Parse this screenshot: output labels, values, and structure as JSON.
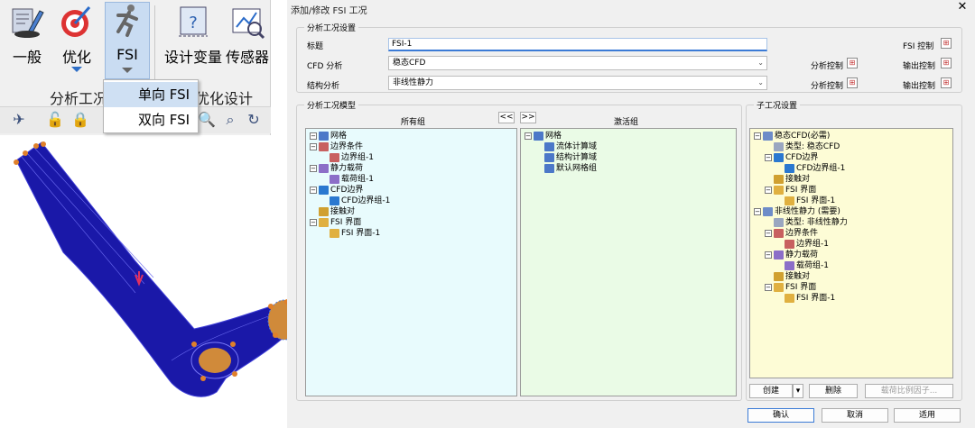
{
  "ribbon": {
    "buttons": [
      {
        "label": "一般",
        "icon": "general-settings-icon"
      },
      {
        "label": "优化",
        "icon": "optimization-target-icon"
      },
      {
        "label": "FSI",
        "icon": "running-man-icon"
      },
      {
        "label": "设计变量",
        "icon": "design-variable-icon"
      },
      {
        "label": "传感器",
        "icon": "sensor-chart-icon"
      }
    ],
    "group_label": "分析工况",
    "group_label2": "优化设计",
    "fsi_menu": [
      "单向 FSI",
      "双向 FSI"
    ]
  },
  "dialog": {
    "title": "添加/修改 FSI 工况",
    "settings": {
      "legend": "分析工况设置",
      "title_label": "标题",
      "title_value": "FSI-1",
      "cfd_label": "CFD 分析",
      "cfd_value": "稳态CFD",
      "struct_label": "结构分析",
      "struct_value": "非线性静力",
      "fsi_control": "FSI 控制",
      "analysis_control": "分析控制",
      "output_control": "输出控制"
    },
    "model": {
      "legend": "分析工况模型",
      "all_groups": "所有组",
      "active_groups": "激活组",
      "btn_left": "<<",
      "btn_right": ">>",
      "left_tree": [
        "网格",
        "边界条件",
        "边界组-1",
        "静力载荷",
        "载荷组-1",
        "CFD边界",
        "CFD边界组-1",
        "接触对",
        "FSI 界面",
        "FSI 界面-1"
      ],
      "right_tree": [
        "网格",
        "流体计算域",
        "结构计算域",
        "默认网格组"
      ]
    },
    "sub": {
      "legend": "子工况设置",
      "tree": [
        "稳态CFD(必需)",
        "类型: 稳态CFD",
        "CFD边界",
        "CFD边界组-1",
        "接触对",
        "FSI 界面",
        "FSI 界面-1",
        "非线性静力 (需要)",
        "类型: 非线性静力",
        "边界条件",
        "边界组-1",
        "静力载荷",
        "载荷组-1",
        "接触对",
        "FSI 界面",
        "FSI 界面-1"
      ],
      "create": "创建",
      "delete": "删除",
      "load_factor": "载荷比例因子..."
    },
    "ok": "确认",
    "cancel": "取消",
    "apply": "适用"
  },
  "colors": {
    "mesh_blue": "#1a18a8",
    "accent": "#3b7bd6",
    "left_panel_bg": "#e8fbfd",
    "mid_panel_bg": "#eafbe6",
    "right_panel_bg": "#fdfcd6"
  }
}
